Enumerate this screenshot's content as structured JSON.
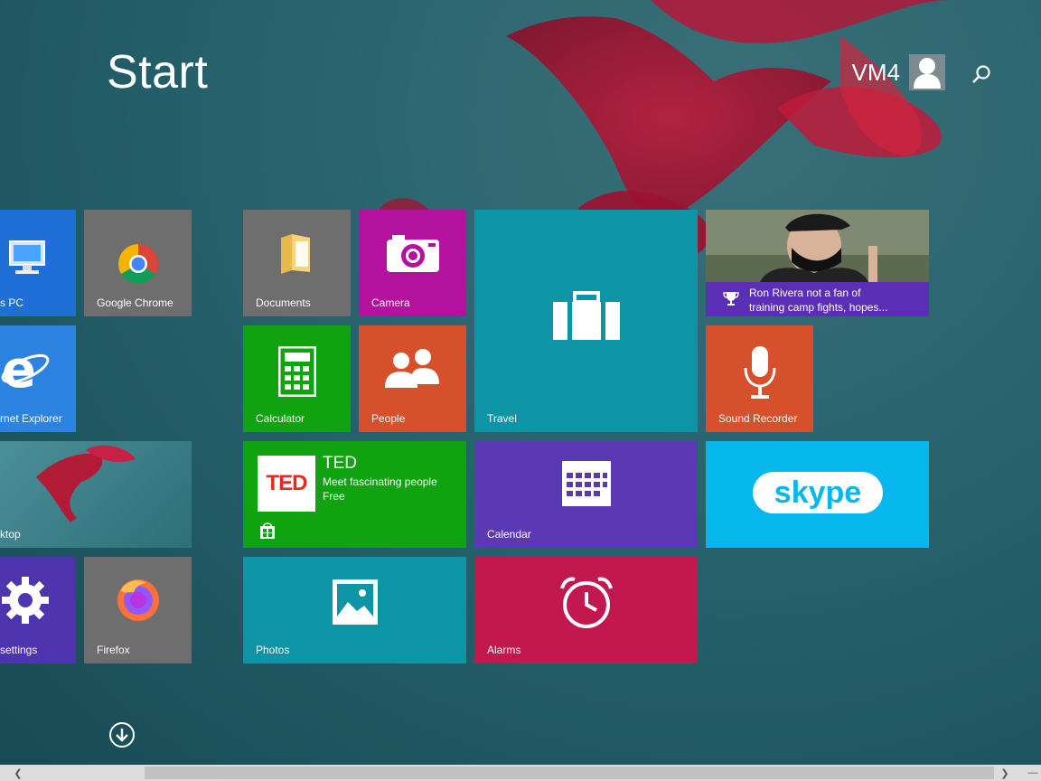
{
  "title": "Start",
  "user": {
    "name": "VM4",
    "icon": "user-avatar-icon"
  },
  "search": {
    "icon": "search-icon"
  },
  "tiles": {
    "this_pc": {
      "label": "s PC",
      "color": "#1f6fd6",
      "icon": "computer-icon"
    },
    "chrome": {
      "label": "Google Chrome",
      "color": "#6e6e6e",
      "icon": "chrome-icon"
    },
    "ie": {
      "label": "rnet Explorer",
      "color": "#2d83e0",
      "icon": "internet-explorer-icon"
    },
    "desktop": {
      "label": "ktop",
      "icon": "desktop-icon"
    },
    "settings": {
      "label": "settings",
      "color": "#4f34b0",
      "icon": "gear-icon"
    },
    "firefox": {
      "label": "Firefox",
      "color": "#6e6e6e",
      "icon": "firefox-icon"
    },
    "documents": {
      "label": "Documents",
      "color": "#6e6e6e",
      "icon": "folder-icon"
    },
    "camera": {
      "label": "Camera",
      "color": "#b4129e",
      "icon": "camera-icon"
    },
    "travel": {
      "label": "Travel",
      "color": "#0e95a5",
      "icon": "suitcase-icon"
    },
    "news": {
      "headline_line1": "Ron Rivera not a fan of",
      "headline_line2": "training camp fights, hopes...",
      "icon": "trophy-icon",
      "band_color": "#5b2fb5"
    },
    "calculator": {
      "label": "Calculator",
      "color": "#10a30f",
      "icon": "calculator-icon"
    },
    "people": {
      "label": "People",
      "color": "#d6512b",
      "icon": "people-icon"
    },
    "sound_recorder": {
      "label": "Sound Recorder",
      "color": "#d6512b",
      "icon": "microphone-icon"
    },
    "ted": {
      "title": "TED",
      "subtitle": "Meet fascinating people",
      "price": "Free",
      "color": "#10a30f",
      "logo": "TED",
      "icon": "store-icon"
    },
    "calendar": {
      "label": "Calendar",
      "color": "#5b39b5",
      "icon": "calendar-icon"
    },
    "skype": {
      "logo": "skype",
      "color": "#05b7ec"
    },
    "photos": {
      "label": "Photos",
      "color": "#0e95a5",
      "icon": "photos-icon"
    },
    "alarms": {
      "label": "Alarms",
      "color": "#c2184f",
      "icon": "alarm-clock-icon"
    }
  },
  "scroll_down": {
    "icon": "arrow-down-circle-icon"
  },
  "scrollbar": {
    "left_icon": "chevron-left-icon",
    "right_icon": "chevron-right-icon",
    "minus_icon": "minus-icon"
  }
}
